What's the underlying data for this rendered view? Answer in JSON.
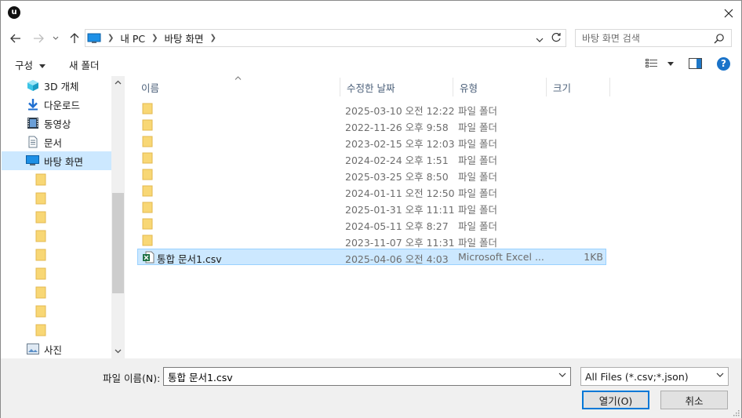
{
  "window": {
    "logo_text": "u"
  },
  "nav": {
    "address_path": [
      "내 PC",
      "바탕 화면"
    ],
    "search_placeholder": "바탕 화면 검색"
  },
  "toolbar": {
    "organize_label": "구성",
    "new_folder_label": "새 폴더"
  },
  "sidebar": {
    "items": [
      {
        "label": "3D 개체",
        "icon": "3d-objects-icon"
      },
      {
        "label": "다운로드",
        "icon": "download-icon"
      },
      {
        "label": "동영상",
        "icon": "video-icon"
      },
      {
        "label": "문서",
        "icon": "document-icon"
      },
      {
        "label": "바탕 화면",
        "icon": "desktop-icon",
        "selected": true
      },
      {
        "label": "",
        "icon": "folder-icon"
      },
      {
        "label": "",
        "icon": "folder-icon"
      },
      {
        "label": "",
        "icon": "folder-icon"
      },
      {
        "label": "",
        "icon": "folder-icon"
      },
      {
        "label": "",
        "icon": "folder-icon"
      },
      {
        "label": "",
        "icon": "folder-icon"
      },
      {
        "label": "",
        "icon": "folder-icon"
      },
      {
        "label": "",
        "icon": "folder-icon"
      },
      {
        "label": "",
        "icon": "folder-icon"
      },
      {
        "label": "사진",
        "icon": "pictures-icon"
      }
    ]
  },
  "list": {
    "columns": [
      "이름",
      "수정한 날짜",
      "유형",
      "크기"
    ],
    "rows": [
      {
        "name": "",
        "date": "2025-03-10 오전 12:22",
        "type": "파일 폴더",
        "size": "",
        "icon": "folder-icon"
      },
      {
        "name": "",
        "date": "2022-11-26 오후 9:58",
        "type": "파일 폴더",
        "size": "",
        "icon": "folder-icon"
      },
      {
        "name": "",
        "date": "2023-02-15 오후 12:03",
        "type": "파일 폴더",
        "size": "",
        "icon": "folder-icon"
      },
      {
        "name": "",
        "date": "2024-02-24 오후 1:51",
        "type": "파일 폴더",
        "size": "",
        "icon": "folder-icon"
      },
      {
        "name": "",
        "date": "2025-03-25 오후 8:50",
        "type": "파일 폴더",
        "size": "",
        "icon": "folder-icon"
      },
      {
        "name": "",
        "date": "2024-01-11 오전 12:50",
        "type": "파일 폴더",
        "size": "",
        "icon": "folder-icon"
      },
      {
        "name": "",
        "date": "2025-01-31 오후 11:11",
        "type": "파일 폴더",
        "size": "",
        "icon": "folder-icon"
      },
      {
        "name": "",
        "date": "2024-05-11 오후 8:27",
        "type": "파일 폴더",
        "size": "",
        "icon": "folder-icon"
      },
      {
        "name": "",
        "date": "2023-11-07 오후 11:31",
        "type": "파일 폴더",
        "size": "",
        "icon": "folder-icon"
      },
      {
        "name": "통합 문서1.csv",
        "date": "2025-04-06 오전 4:03",
        "type": "Microsoft Excel ...",
        "size": "1KB",
        "icon": "excel-csv-icon",
        "selected": true
      }
    ]
  },
  "footer": {
    "filename_label": "파일 이름(N):",
    "filename_value": "통합 문서1.csv",
    "filter_value": "All Files (*.csv;*.json)",
    "open_label": "열기(O)",
    "cancel_label": "취소"
  },
  "colors": {
    "selection_bg": "#cce8ff",
    "selection_border": "#99d1ff",
    "accent": "#0078d7",
    "folder_yellow": "#f8d775"
  }
}
